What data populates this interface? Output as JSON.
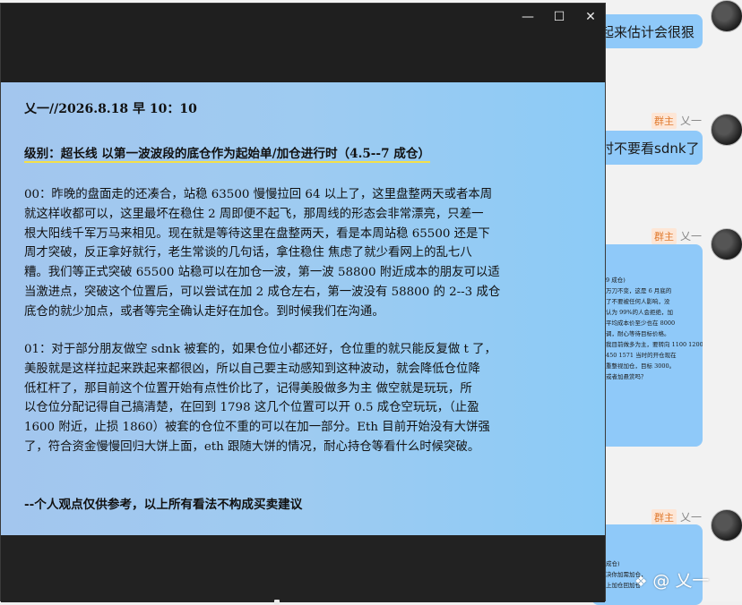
{
  "document": {
    "header": "乂一//2026.8.18 早 10：10",
    "level_line": "级别：超长线 以第一波波段的底仓作为起始单/加仓进行时（4.5--7 成仓）",
    "para1_lines": [
      "00：昨晚的盘面走的还凑合，站稳 63500 慢慢拉回 64 以上了，这里盘整两天或者本周",
      "就这样收都可以，这里最坏在稳住 2 周即便不起飞，那周线的形态会非常漂亮，只差一",
      "根大阳线千军万马来相见。现在就是等待这里在盘整两天，看是本周站稳 65500 还是下",
      "周才突破，反正拿好就行，老生常谈的几句话，拿住稳住 焦虑了就少看网上的乱七八",
      "糟。我们等正式突破 65500 站稳可以在加仓一波，第一波 58800 附近成本的朋友可以适",
      "当激进点，突破这个位置后，可以尝试在加 2 成仓左右，第一波没有 58800 的 2--3 成仓",
      "底仓的就少加点，或者等完全确认走好在加仓。到时候我们在沟通。"
    ],
    "para2_lines": [
      "01：对于部分朋友做空 sdnk 被套的，如果仓位小都还好，仓位重的就只能反复做 t 了，",
      "美股就是这样拉起来跌起来都很凶，所以自己要主动感知到这种波动，就会降低仓位降",
      "低杠杆了，那目前这个位置开始有点性价比了，记得美股做多为主 做空就是玩玩，所",
      "以仓位分配记得自己搞清楚，在回到 1798 这几个位置可以开 0.5 成仓空玩玩，（止盈",
      "1600 附近，止损 1860）被套的仓位不重的可以在加一部分。Eth 目前开始没有大饼强",
      "了，符合资金慢慢回归大饼上面，eth 跟随大饼的情况，耐心持仓等看什么时候突破。"
    ],
    "disclaimer": "--个人观点仅供参考，以上所有看法不构成买卖建议"
  },
  "window": {
    "minimize_glyph": "—",
    "maximize_glyph": "☐",
    "close_glyph": "✕"
  },
  "chat": {
    "bubble1_text": "起来估计会很狠",
    "bubble2_text": "时不要看sdnk了",
    "role_tag": "群主",
    "sender_name": "乂一",
    "bubble3_lines": [
      "9 成仓)",
      "万刀不变，这是 6 月底的",
      "了不要被任何人影响，没",
      "认为 99%的人会拒绝，加",
      "平均成本价至少也在 8000",
      "调，耐心等待目标价格。",
      "我目前做多为主，要转向 1100  1200",
      "450 1571 当时的开仓现在",
      "重整视加仓，目标 3000。",
      "",
      "或者加悬赏吗？"
    ],
    "bubble4_lines": [
      "成仓)",
      "决你加需加仓，",
      "上加仓回加仓"
    ]
  },
  "watermark": "@ 乂一",
  "colors": {
    "doc_gradient_left": "#a3c6ee",
    "doc_gradient_right": "#8ccbf6",
    "window_dark": "#1f1f1f",
    "bubble": "#8fc9f9",
    "role_tag": "#e07a2f",
    "highlight_underline": "#f4e04a"
  }
}
